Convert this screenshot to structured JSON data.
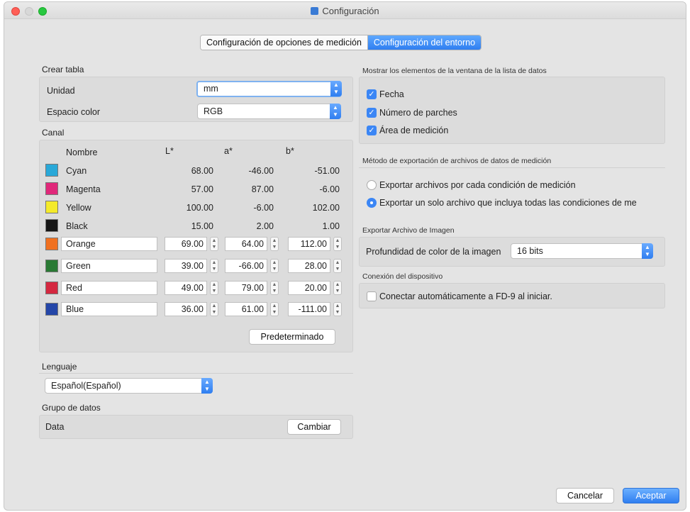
{
  "window": {
    "title": "Configuración"
  },
  "tabs": [
    {
      "label": "Configuración de opciones de medición",
      "active": false
    },
    {
      "label": "Configuración del entorno",
      "active": true
    }
  ],
  "crear_tabla": {
    "heading": "Crear tabla",
    "unidad_label": "Unidad",
    "unidad_value": "mm",
    "espacio_label": "Espacio color",
    "espacio_value": "RGB"
  },
  "canal": {
    "heading": "Canal",
    "headers": {
      "nombre": "Nombre",
      "l": "L*",
      "a": "a*",
      "b": "b*"
    },
    "fixed_rows": [
      {
        "name": "Cyan",
        "color": "#29a8d8",
        "l": "68.00",
        "a": "-46.00",
        "b": "-51.00"
      },
      {
        "name": "Magenta",
        "color": "#e0287a",
        "l": "57.00",
        "a": "87.00",
        "b": "-6.00"
      },
      {
        "name": "Yellow",
        "color": "#f4ea2a",
        "l": "100.00",
        "a": "-6.00",
        "b": "102.00"
      },
      {
        "name": "Black",
        "color": "#161616",
        "l": "15.00",
        "a": "2.00",
        "b": "1.00"
      }
    ],
    "edit_rows": [
      {
        "name": "Orange",
        "color": "#f07020",
        "l": "69.00",
        "a": "64.00",
        "b": "112.00"
      },
      {
        "name": "Green",
        "color": "#2a7a34",
        "l": "39.00",
        "a": "-66.00",
        "b": "28.00"
      },
      {
        "name": "Red",
        "color": "#d42840",
        "l": "49.00",
        "a": "79.00",
        "b": "20.00"
      },
      {
        "name": "Blue",
        "color": "#2446a8",
        "l": "36.00",
        "a": "61.00",
        "b": "-111.00"
      }
    ],
    "default_button": "Predeterminado"
  },
  "lenguaje": {
    "heading": "Lenguaje",
    "value": "Español(Español)"
  },
  "grupo": {
    "heading": "Grupo de datos",
    "value": "Data",
    "button": "Cambiar"
  },
  "mostrar": {
    "heading": "Mostrar los elementos de la ventana de la lista de datos",
    "items": [
      {
        "label": "Fecha",
        "checked": true
      },
      {
        "label": "Número de parches",
        "checked": true
      },
      {
        "label": "Área de medición",
        "checked": true
      }
    ]
  },
  "export_method": {
    "heading": "Método de exportación de archivos de datos de medición",
    "options": [
      {
        "label": "Exportar archivos por cada condición de medición",
        "selected": false
      },
      {
        "label": "Exportar un solo archivo que incluya todas las condiciones de me",
        "selected": true
      }
    ]
  },
  "export_image": {
    "heading": "Exportar Archivo de Imagen",
    "depth_label": "Profundidad de color de la imagen",
    "depth_value": "16 bits"
  },
  "device": {
    "heading": "Conexión del dispositivo",
    "auto_label": "Conectar automáticamente a FD-9 al iniciar.",
    "checked": false
  },
  "footer": {
    "cancel": "Cancelar",
    "accept": "Aceptar"
  }
}
